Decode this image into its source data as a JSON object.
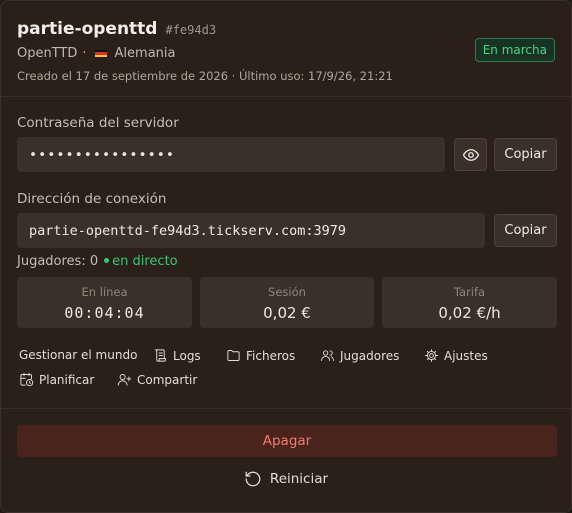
{
  "server": {
    "name": "partie-openttd",
    "hash": "#fe94d3",
    "game": "OpenTTD",
    "separator": "·",
    "region": "Alemania",
    "meta": "Creado el 17 de septiembre de 2026 · Último uso: 17/9/26, 21:21",
    "status": "En marcha"
  },
  "password": {
    "label": "Contraseña del servidor",
    "masked_value": "••••••••••••••••",
    "copy_label": "Copiar"
  },
  "connection": {
    "label": "Dirección de conexión",
    "value": "partie-openttd-fe94d3.tickserv.com:3979",
    "copy_label": "Copiar"
  },
  "players": {
    "label": "Jugadores: 0",
    "live_label": "en directo"
  },
  "stats": [
    {
      "label": "En línea",
      "value": "00:04:04"
    },
    {
      "label": "Sesión",
      "value": "0,02 €"
    },
    {
      "label": "Tarifa",
      "value": "0,02 €/h"
    }
  ],
  "actions": {
    "manage_world": "Gestionar el mundo",
    "logs": "Logs",
    "files": "Ficheros",
    "players": "Jugadores",
    "settings": "Ajustes",
    "schedule": "Planificar",
    "share": "Compartir"
  },
  "controls": {
    "stop": "Apagar",
    "restart": "Reiniciar"
  },
  "icons": {
    "flag": "germany-flag-icon",
    "eye": "eye-icon",
    "logs": "scroll-icon",
    "files": "folder-icon",
    "players": "users-icon",
    "settings": "gear-icon",
    "schedule": "calendar-clock-icon",
    "share": "user-plus-icon",
    "restart": "restart-icon"
  },
  "colors": {
    "status_green": "#39c575",
    "stop_red": "#f07d6e",
    "background": "#2a2019"
  }
}
